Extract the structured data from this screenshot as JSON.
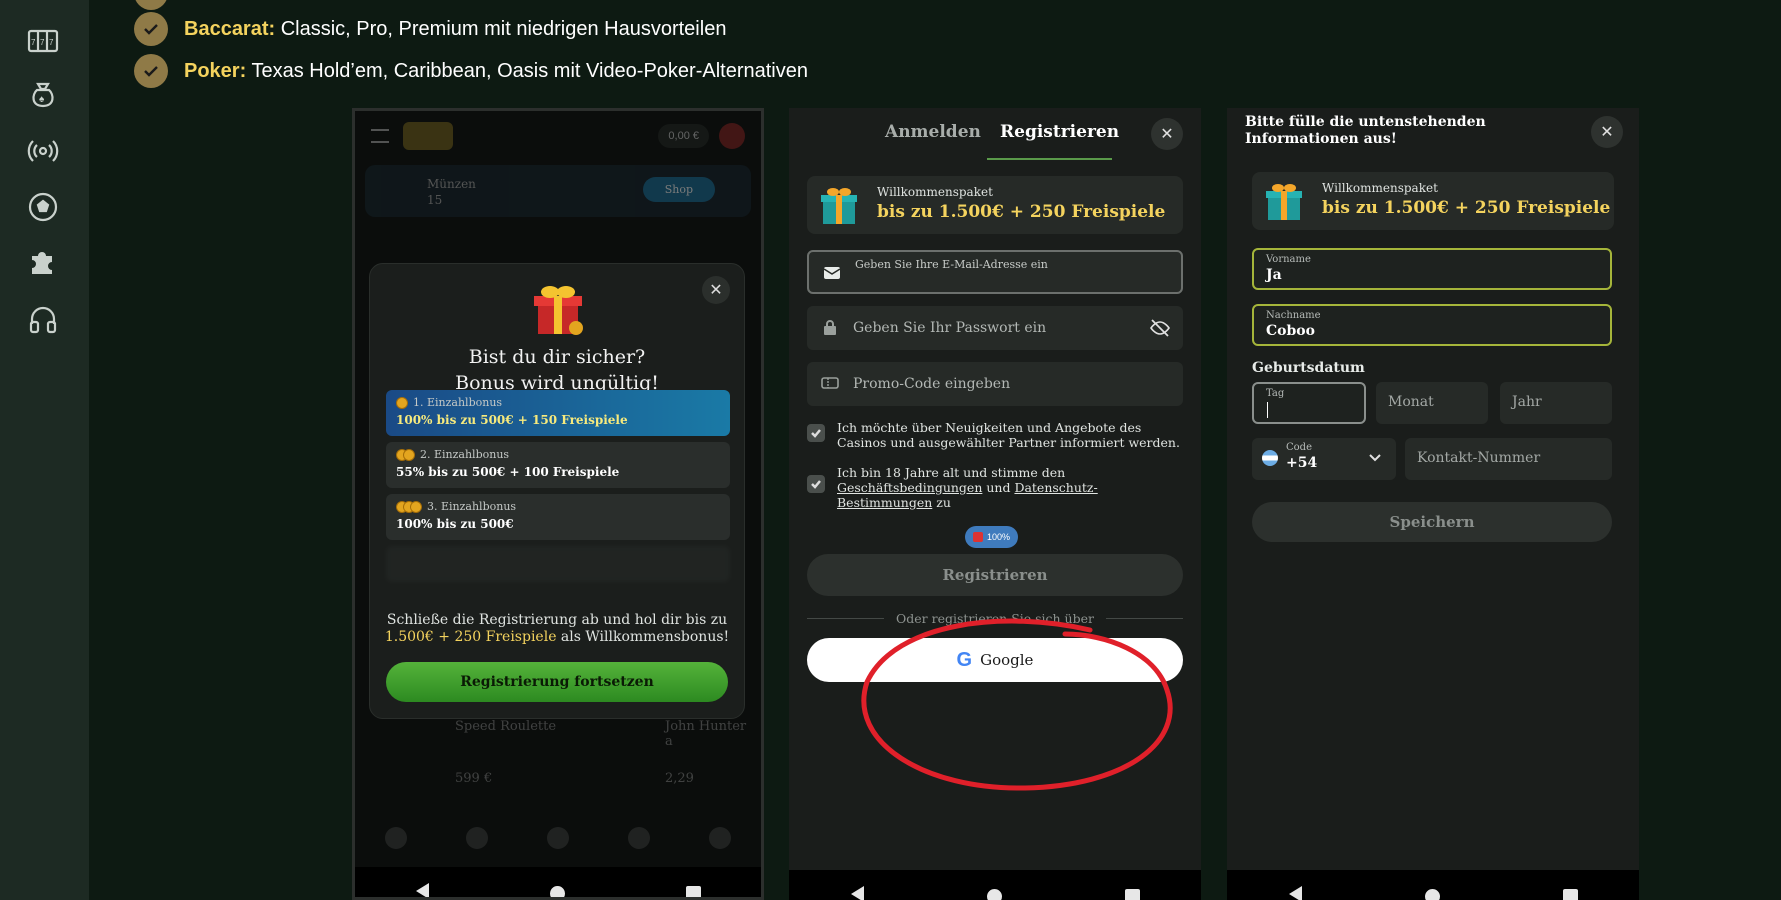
{
  "sidebar": {
    "icons": [
      "slot-machine-icon",
      "money-bag-icon",
      "live-broadcast-icon",
      "soccer-ball-icon",
      "puzzle-icon",
      "headphones-icon"
    ]
  },
  "bullets": [
    {
      "title": "Baccarat:",
      "text": " Classic, Pro, Premium mit niedrigen Hausvorteilen"
    },
    {
      "title": "Poker:",
      "text": " Texas Hold’em, Caribbean, Oasis mit Video-Poker-Alternativen"
    }
  ],
  "phone1": {
    "balance": "0,00 €",
    "coins_label": "Münzen",
    "coins_value": "15",
    "shop_label": "Shop",
    "modal": {
      "title_line1": "Bist du dir sicher?",
      "title_line2": "Bonus wird ungültig!",
      "bonuses": [
        {
          "label": "1. Einzahlbonus",
          "value": "100% bis zu 500€ + 150 Freispiele"
        },
        {
          "label": "2. Einzahlbonus",
          "value": "55% bis zu 500€ + 100 Freispiele"
        },
        {
          "label": "3. Einzahlbonus",
          "value": "100% bis zu 500€"
        }
      ],
      "desc_part1": "Schließe die Registrierung ab und hol dir bis zu",
      "desc_highlight": "1.500€ + 250 Freispiele",
      "desc_part2": " als Willkommensbonus!",
      "button": "Registrierung fortsetzen"
    },
    "games": [
      {
        "title": "Speed Roulette",
        "price": "599 €"
      },
      {
        "title": "John Hunter a",
        "price": "2,29"
      }
    ]
  },
  "phone2": {
    "tab_login": "Anmelden",
    "tab_register": "Registrieren",
    "welcome_label": "Willkommenspaket",
    "welcome_value": "bis zu 1.500€ + 250 Freispiele",
    "email_placeholder": "Geben Sie Ihre E-Mail-Adresse ein",
    "password_placeholder": "Geben Sie Ihr Passwort ein",
    "promo_placeholder": "Promo-Code eingeben",
    "checkbox1": "Ich möchte über Neuigkeiten und Angebote des Casinos und ausgewählter Partner informiert werden.",
    "checkbox2_a": "Ich bin 18 Jahre alt und stimme den ",
    "checkbox2_link1": "Geschäftsbedingungen",
    "checkbox2_b": " und ",
    "checkbox2_link2": "Datenschutz-Bestimmungen",
    "checkbox2_c": " zu",
    "badge": "100%",
    "register_button": "Registrieren",
    "divider_text": "Oder registrieren Sie sich über",
    "google_button": "Google"
  },
  "phone3": {
    "title": "Bitte fülle die untenstehenden Informationen aus!",
    "welcome_label": "Willkommenspaket",
    "welcome_value": "bis zu 1.500€ + 250 Freispiele",
    "firstname_label": "Vorname",
    "firstname_value": "Ja",
    "lastname_label": "Nachname",
    "lastname_value": "Coboo",
    "birthdate_label": "Geburtsdatum",
    "day_label": "Tag",
    "month_placeholder": "Monat",
    "year_placeholder": "Jahr",
    "code_label": "Code",
    "code_value": "+54",
    "phone_placeholder": "Kontakt-Nummer",
    "save_button": "Speichern"
  },
  "colors": {
    "accent_gold": "#f4d35e",
    "annotation_red": "#e0202a",
    "green_button": "#3e9e2a"
  }
}
